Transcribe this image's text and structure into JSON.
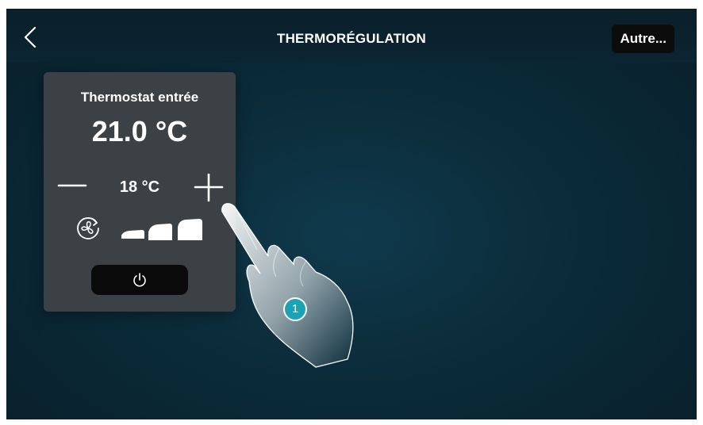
{
  "header": {
    "title": "THERMORÉGULATION",
    "other_label": "Autre..."
  },
  "thermostat": {
    "name": "Thermostat entrée",
    "temperature": "21.0 °C",
    "setpoint": "18 °C",
    "fan_speed_levels": 3
  },
  "annotation": {
    "step": "1"
  },
  "icons": [
    "back-chevron-icon",
    "minus-icon",
    "plus-icon",
    "fan-icon",
    "power-icon",
    "hand-pointer-icon"
  ],
  "colors": {
    "background": "#0b2b39",
    "card": "#3c4145",
    "button_dark": "#0a0a0a",
    "badge": "#1aa3b5",
    "text": "#ffffff"
  }
}
